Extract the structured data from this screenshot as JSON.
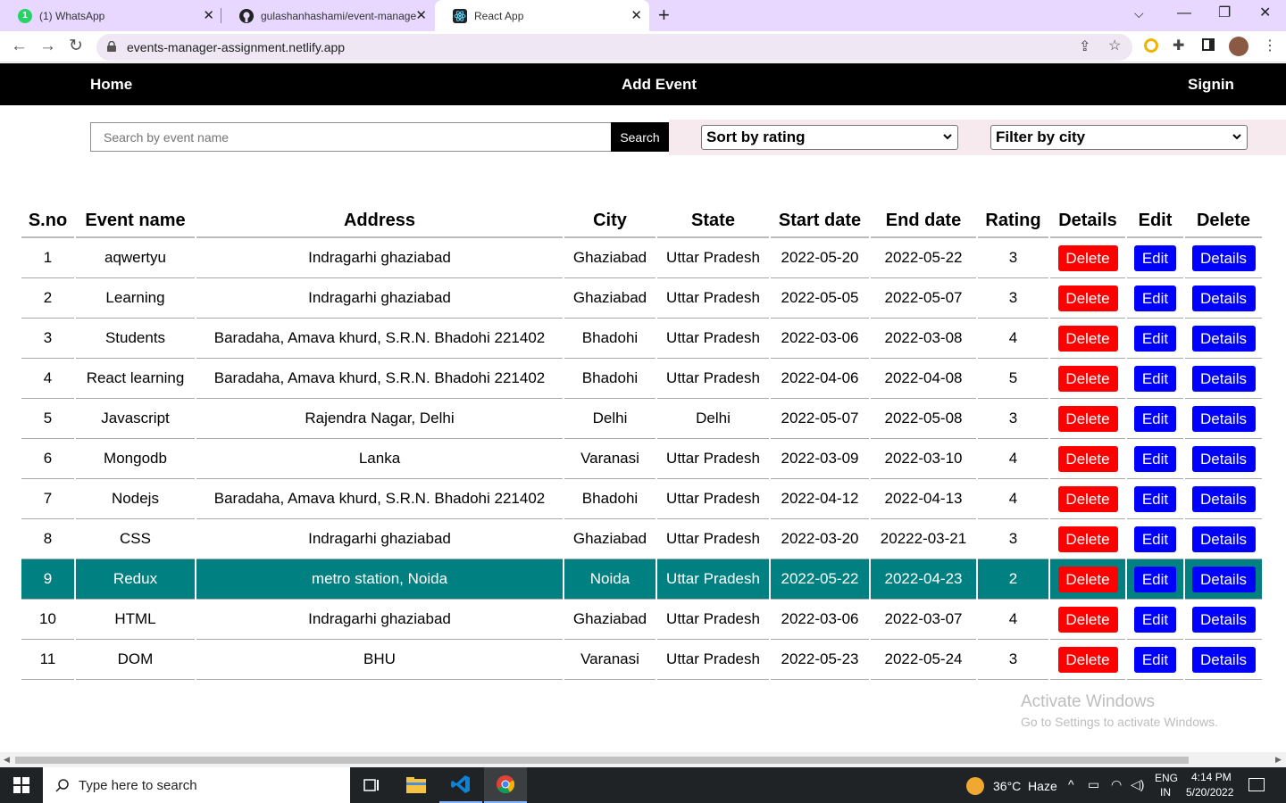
{
  "browser": {
    "tabs": [
      {
        "title": "(1) WhatsApp",
        "favicon_text": "1",
        "favicon_color": "#25d366",
        "active": false
      },
      {
        "title": "gulashanhashami/event-manage",
        "active": false
      },
      {
        "title": "React App",
        "active": true
      }
    ],
    "url": "events-manager-assignment.netlify.app"
  },
  "nav": {
    "home": "Home",
    "add_event": "Add Event",
    "signin": "Signin"
  },
  "controls": {
    "search_placeholder": "Search by event name",
    "search_button": "Search",
    "sort_selected": "Sort by rating",
    "filter_selected": "Filter by city"
  },
  "table": {
    "headers": [
      "S.no",
      "Event name",
      "Address",
      "City",
      "State",
      "Start date",
      "End date",
      "Rating",
      "Details",
      "Edit",
      "Delete"
    ],
    "button_labels": {
      "delete": "Delete",
      "edit": "Edit",
      "details": "Details"
    },
    "highlighted_row": 9,
    "rows": [
      {
        "sno": "1",
        "name": "aqwertyu",
        "address": "Indragarhi ghaziabad",
        "city": "Ghaziabad",
        "state": "Uttar Pradesh",
        "start": "2022-05-20",
        "end": "2022-05-22",
        "rating": "3"
      },
      {
        "sno": "2",
        "name": "Learning",
        "address": "Indragarhi ghaziabad",
        "city": "Ghaziabad",
        "state": "Uttar Pradesh",
        "start": "2022-05-05",
        "end": "2022-05-07",
        "rating": "3"
      },
      {
        "sno": "3",
        "name": "Students",
        "address": "Baradaha, Amava khurd, S.R.N. Bhadohi 221402",
        "city": "Bhadohi",
        "state": "Uttar Pradesh",
        "start": "2022-03-06",
        "end": "2022-03-08",
        "rating": "4"
      },
      {
        "sno": "4",
        "name": "React learning",
        "address": "Baradaha, Amava khurd, S.R.N. Bhadohi 221402",
        "city": "Bhadohi",
        "state": "Uttar Pradesh",
        "start": "2022-04-06",
        "end": "2022-04-08",
        "rating": "5"
      },
      {
        "sno": "5",
        "name": "Javascript",
        "address": "Rajendra Nagar, Delhi",
        "city": "Delhi",
        "state": "Delhi",
        "start": "2022-05-07",
        "end": "2022-05-08",
        "rating": "3"
      },
      {
        "sno": "6",
        "name": "Mongodb",
        "address": "Lanka",
        "city": "Varanasi",
        "state": "Uttar Pradesh",
        "start": "2022-03-09",
        "end": "2022-03-10",
        "rating": "4"
      },
      {
        "sno": "7",
        "name": "Nodejs",
        "address": "Baradaha, Amava khurd, S.R.N. Bhadohi 221402",
        "city": "Bhadohi",
        "state": "Uttar Pradesh",
        "start": "2022-04-12",
        "end": "2022-04-13",
        "rating": "4"
      },
      {
        "sno": "8",
        "name": "CSS",
        "address": "Indragarhi ghaziabad",
        "city": "Ghaziabad",
        "state": "Uttar Pradesh",
        "start": "2022-03-20",
        "end": "20222-03-21",
        "rating": "3"
      },
      {
        "sno": "9",
        "name": "Redux",
        "address": "metro station, Noida",
        "city": "Noida",
        "state": "Uttar Pradesh",
        "start": "2022-05-22",
        "end": "2022-04-23",
        "rating": "2"
      },
      {
        "sno": "10",
        "name": "HTML",
        "address": "Indragarhi ghaziabad",
        "city": "Ghaziabad",
        "state": "Uttar Pradesh",
        "start": "2022-03-06",
        "end": "2022-03-07",
        "rating": "4"
      },
      {
        "sno": "11",
        "name": "DOM",
        "address": "BHU",
        "city": "Varanasi",
        "state": "Uttar Pradesh",
        "start": "2022-05-23",
        "end": "2022-05-24",
        "rating": "3"
      }
    ]
  },
  "watermark": {
    "line1": "Activate Windows",
    "line2": "Go to Settings to activate Windows."
  },
  "taskbar": {
    "search_placeholder": "Type here to search",
    "weather": "36°C  Haze",
    "lang": "ENG",
    "region": "IN",
    "time": "4:14 PM",
    "date": "5/20/2022"
  },
  "colors": {
    "highlight_row": "#008080",
    "delete_button": "#ff0000",
    "edit_button": "#0000ff",
    "navbar": "#000000",
    "tabstrip": "#e8d8ff"
  }
}
